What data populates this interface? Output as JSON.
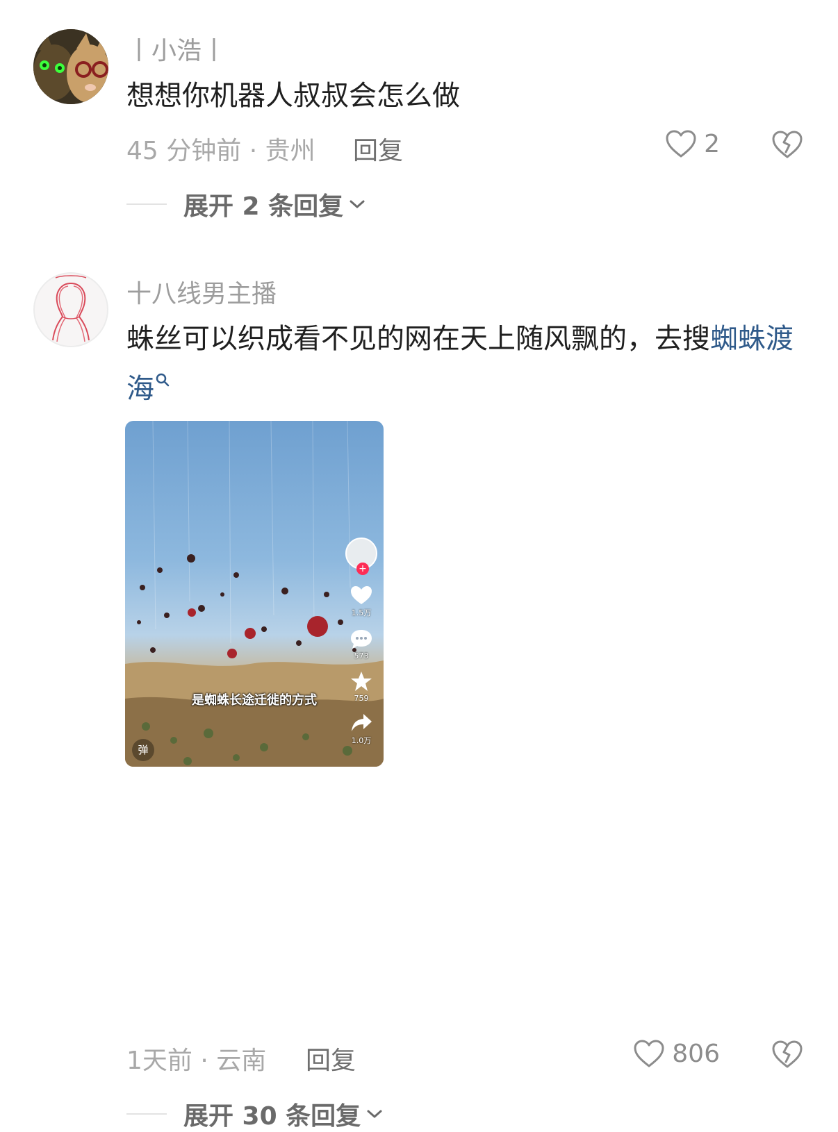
{
  "comments": [
    {
      "username": "丨小浩丨",
      "text": "想想你机器人叔叔会怎么做",
      "time_location": "45 分钟前 · 贵州",
      "reply_label": "回复",
      "likes": "2",
      "expand_label": "展开 2 条回复"
    },
    {
      "username": "十八线男主播",
      "text": "蛛丝可以织成看不见的网在天上随风飘的，去搜",
      "link_text": "蜘蛛渡海",
      "time_location": "1天前 · 云南",
      "reply_label": "回复",
      "likes": "806",
      "expand_label": "展开 30 条回复",
      "video": {
        "caption": "是蜘蛛长途迁徙的方式",
        "like_count": "1.5万",
        "comment_count": "573",
        "favorite_count": "759",
        "share_count": "1.0万",
        "danmu_label": "弹",
        "follow_symbol": "+"
      }
    }
  ],
  "colors": {
    "link": "#2f5a8a",
    "meta": "#a8a8a8",
    "username": "#9d9d9d",
    "follow": "#fe2c55"
  }
}
